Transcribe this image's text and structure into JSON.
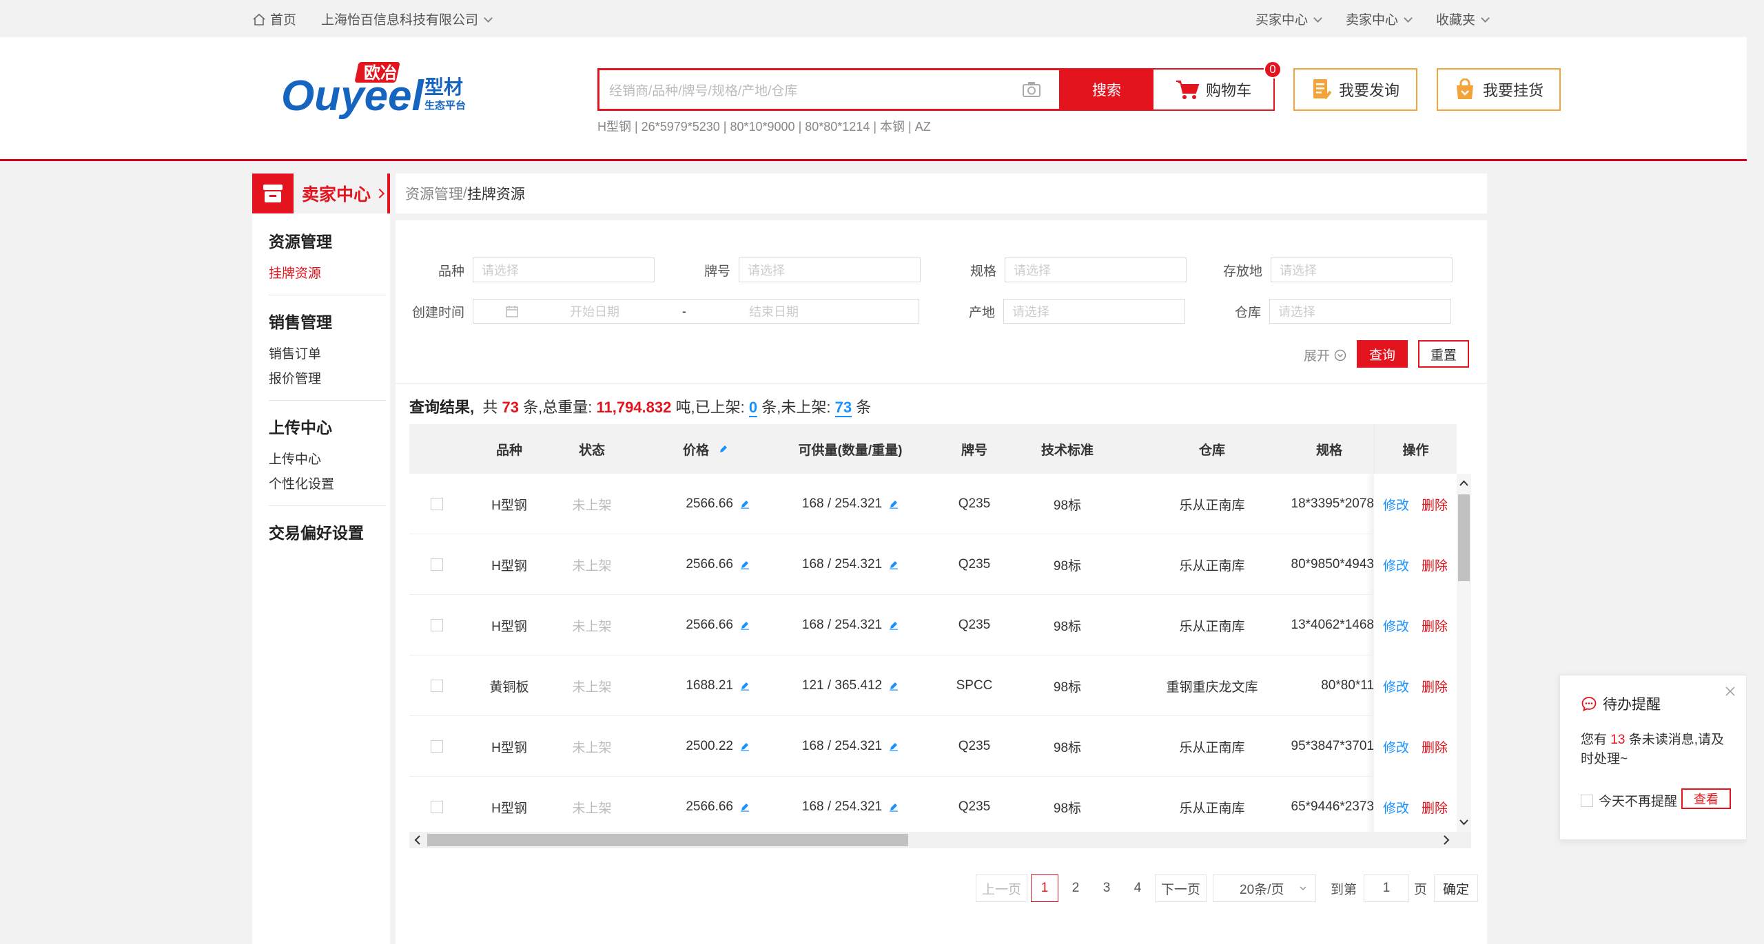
{
  "topbar": {
    "home": "首页",
    "company": "上海怡百信息科技有限公司",
    "buyer_center": "买家中心",
    "seller_center": "卖家中心",
    "favorites": "收藏夹"
  },
  "header": {
    "logo_text": "Ouyeel",
    "logo_badge": "欧冶",
    "logo_sub1": "型材",
    "logo_sub2": "生态平台",
    "search_placeholder": "经销商/品种/牌号/规格/产地/仓库",
    "search_btn": "搜索",
    "cart_label": "购物车",
    "cart_count": "0",
    "inquiry_label": "我要发询",
    "listing_label": "我要挂货",
    "hot_keywords": "H型钢 | 26*5979*5230 | 80*10*9000 | 80*80*1214 | 本钢 | AZ"
  },
  "sidebar": {
    "title": "卖家中心",
    "groups": [
      {
        "title": "资源管理",
        "items": [
          "挂牌资源"
        ]
      },
      {
        "title": "销售管理",
        "items": [
          "销售订单",
          "报价管理"
        ]
      },
      {
        "title": "上传中心",
        "items": [
          "上传中心",
          "个性化设置"
        ]
      },
      {
        "title": "交易偏好设置",
        "items": []
      }
    ]
  },
  "breadcrumb": {
    "parent": "资源管理",
    "sep": "/",
    "current": "挂牌资源"
  },
  "filters": {
    "variety_label": "品种",
    "variety_ph": "请选择",
    "grade_label": "牌号",
    "grade_ph": "请选择",
    "spec_label": "规格",
    "spec_ph": "请选择",
    "location_label": "存放地",
    "location_ph": "请选择",
    "created_label": "创建时间",
    "start_ph": "开始日期",
    "dash": "-",
    "end_ph": "结束日期",
    "origin_label": "产地",
    "origin_ph": "请选择",
    "warehouse_label": "仓库",
    "warehouse_ph": "请选择",
    "expand": "展开",
    "query": "查询",
    "reset": "重置"
  },
  "summary": {
    "label": "查询结果,",
    "p1": "共",
    "total": "73",
    "p2": "条,总重量:",
    "weight": "11,794.832",
    "p3": "吨,已上架:",
    "on": "0",
    "p4": "条,未上架:",
    "off": "73",
    "p5": "条"
  },
  "table": {
    "headers": [
      "品种",
      "状态",
      "价格",
      "可供量(数量/重量)",
      "牌号",
      "技术标准",
      "仓库",
      "规格",
      "操作"
    ],
    "rows": [
      {
        "variety": "H型钢",
        "status": "未上架",
        "price": "2566.66",
        "supply": "168 / 254.321",
        "grade": "Q235",
        "standard": "98标",
        "warehouse": "乐从正南库",
        "spec": "18*3395*2078"
      },
      {
        "variety": "H型钢",
        "status": "未上架",
        "price": "2566.66",
        "supply": "168 / 254.321",
        "grade": "Q235",
        "standard": "98标",
        "warehouse": "乐从正南库",
        "spec": "80*9850*4943"
      },
      {
        "variety": "H型钢",
        "status": "未上架",
        "price": "2566.66",
        "supply": "168 / 254.321",
        "grade": "Q235",
        "standard": "98标",
        "warehouse": "乐从正南库",
        "spec": "13*4062*1468"
      },
      {
        "variety": "黄铜板",
        "status": "未上架",
        "price": "1688.21",
        "supply": "121 / 365.412",
        "grade": "SPCC",
        "standard": "98标",
        "warehouse": "重钢重庆龙文库",
        "spec": "80*80*11"
      },
      {
        "variety": "H型钢",
        "status": "未上架",
        "price": "2500.22",
        "supply": "168 / 254.321",
        "grade": "Q235",
        "standard": "98标",
        "warehouse": "乐从正南库",
        "spec": "95*3847*3701"
      },
      {
        "variety": "H型钢",
        "status": "未上架",
        "price": "2566.66",
        "supply": "168 / 254.321",
        "grade": "Q235",
        "standard": "98标",
        "warehouse": "乐从正南库",
        "spec": "65*9446*2373"
      }
    ],
    "modify": "修改",
    "delete": "删除"
  },
  "pager": {
    "prev": "上一页",
    "pages": [
      "1",
      "2",
      "3",
      "4"
    ],
    "next": "下一页",
    "size": "20条/页",
    "goto": "到第",
    "page_input": "1",
    "page_unit": "页",
    "confirm": "确定"
  },
  "popup": {
    "title": "待办提醒",
    "msg1": "您有",
    "count": "13",
    "msg2": "条未读消息,请及时处理~",
    "dont_remind": "今天不再提醒",
    "view": "查看"
  },
  "colors": {
    "brand": "#e4141e",
    "link": "#1890ff",
    "accent": "#f2a33a"
  }
}
